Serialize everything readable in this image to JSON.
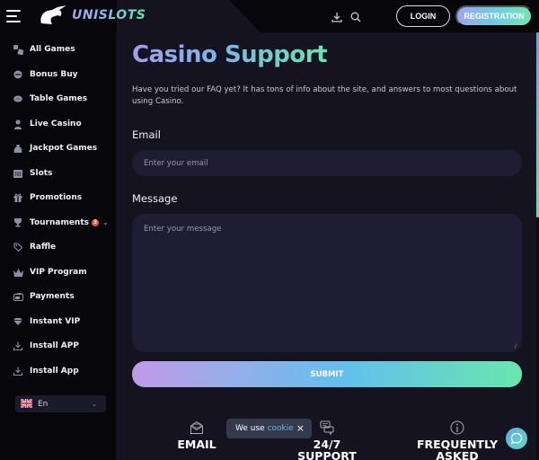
{
  "header": {
    "brand": "UNISLOTS",
    "icons": {
      "menu": "hamburger-icon",
      "logo": "unicorn-icon",
      "download": "download-icon",
      "search": "search-icon"
    },
    "login_label": "LOGIN",
    "registration_label": "REGISTRATION"
  },
  "sidebar": {
    "items": [
      {
        "label": "All Games",
        "icon": "dice-icon"
      },
      {
        "label": "Bonus Buy",
        "icon": "coin-icon"
      },
      {
        "label": "Table Games",
        "icon": "chip-icon"
      },
      {
        "label": "Live Casino",
        "icon": "dealer-icon"
      },
      {
        "label": "Jackpot Games",
        "icon": "money-bag-icon"
      },
      {
        "label": "Slots",
        "icon": "slot-machine-icon"
      },
      {
        "label": "Promotions",
        "icon": "gift-icon"
      },
      {
        "label": "Tournaments",
        "icon": "trophy-icon",
        "badge": "3"
      },
      {
        "label": "Raffle",
        "icon": "tag-icon"
      },
      {
        "label": "VIP Program",
        "icon": "crown-icon"
      },
      {
        "label": "Payments",
        "icon": "wallet-icon"
      },
      {
        "label": "Instant VIP",
        "icon": "diamond-icon"
      },
      {
        "label": "Install APP",
        "icon": "download-icon"
      },
      {
        "label": "Install App",
        "icon": "download-icon"
      }
    ],
    "language": {
      "value": "En",
      "flag": "uk-flag-icon"
    }
  },
  "main": {
    "title": "Casino Support",
    "intro": "Have you tried our FAQ yet? It has tons of info about the site, and answers to most questions about using Casino.",
    "email_label": "Email",
    "email_placeholder": "Enter your email",
    "email_value": "",
    "message_label": "Message",
    "message_placeholder": "Enter your message",
    "message_value": "",
    "submit_label": "SUBMIT",
    "features": [
      {
        "title": "EMAIL",
        "icon": "envelope-icon"
      },
      {
        "title": "24/7 SUPPORT",
        "icon": "chat-bubbles-icon"
      },
      {
        "title": "FREQUENTLY ASKED",
        "icon": "info-icon"
      }
    ]
  },
  "cookie_banner": {
    "text": "We use ",
    "link": "cookie",
    "close": "×"
  },
  "colors": {
    "accent_purple": "#a89cea",
    "accent_blue": "#62c0ec",
    "accent_green": "#69e6ad",
    "background": "#14131f",
    "sidebar_bg": "#07070b",
    "input_bg": "#1f1d33",
    "badge_red": "#e0533d"
  }
}
